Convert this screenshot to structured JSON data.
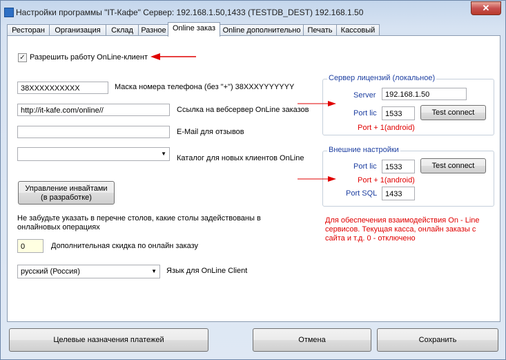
{
  "window": {
    "title": "Настройки программы \"IT-Кафе\"  Сервер: 192.168.1.50,1433 (TESTDB_DEST) 192.168.1.50",
    "close_label": "✕"
  },
  "tabs": [
    {
      "label": "Ресторан"
    },
    {
      "label": "Организация"
    },
    {
      "label": "Склад"
    },
    {
      "label": "Разное"
    },
    {
      "label": "Online заказ",
      "active": true
    },
    {
      "label": "Online дополнительно"
    },
    {
      "label": "Печать"
    },
    {
      "label": "Кассовый"
    }
  ],
  "online": {
    "enable_checkbox_label": "Разрешить работу OnLine-клиент",
    "enable_checked": true,
    "phone_mask_value": "38XXXXXXXXXX",
    "phone_mask_label": "Маска номера телефона (без \"+\") 38XXXYYYYYYY",
    "webserver_value": "http://it-kafe.com/online//",
    "webserver_label": "Ссылка на вебсервер OnLine заказов",
    "email_value": "",
    "email_label": "E-Mail для отзывов",
    "catalog_value": "",
    "catalog_label": "Каталог для новых клиентов OnLine",
    "invites_button": "Управление инвайтами\n(в разработке)",
    "invites_line1": "Управление инвайтами",
    "invites_line2": "(в разработке)",
    "tables_note": "Не забудьте указать в перечне столов, какие столы задействованы в онлайновых операциях",
    "discount_value": "0",
    "discount_label": "Дополнительная скидка по онлайн заказу",
    "language_value": "русский (Россия)",
    "language_label": "Язык для OnLine Client"
  },
  "license_server": {
    "title": "Сервер лицензий (локальное)",
    "server_label": "Server",
    "server_value": "192.168.1.50",
    "port_label": "Port lic",
    "port_value": "1533",
    "test_button": "Test connect",
    "note": "Port + 1(android)"
  },
  "external": {
    "title": "Внешние настройки",
    "port_label": "Port lic",
    "port_value": "1533",
    "test_button": "Test connect",
    "note": "Port + 1(android)",
    "sql_label": "Port SQL",
    "sql_value": "1433"
  },
  "info_note": "Для обеспечения взаимодействия On - Line сервисов. Текущая касса, онлайн заказы с сайта и т.д. 0 - отключено",
  "bottom": {
    "payments_button": "Целевые назначения платежей",
    "cancel_button": "Отмена",
    "save_button": "Сохранить"
  },
  "colors": {
    "accent_blue": "#1c3ea0",
    "note_red": "#e00000",
    "arrow_red": "#e00000"
  }
}
